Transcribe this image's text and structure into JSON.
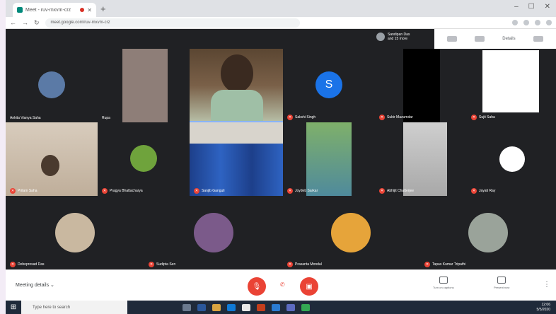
{
  "browser": {
    "tab_title": "Meet - ruv-mxvm-crz",
    "url": "meet.google.com/ruv-mxvm-crz"
  },
  "meet": {
    "presenter_label": "Sandipan Das",
    "presenter_sub": "and 15 more",
    "top_right": [
      "Share",
      "Chat",
      "Details"
    ],
    "meeting_details_label": "Meeting details",
    "present_now_label": "Turn on captions",
    "present_label": "Present now",
    "end_call_symbol": "✆"
  },
  "participants": [
    {
      "name": "Ankita Vianya Saha",
      "muted": false
    },
    {
      "name": "Rupa",
      "muted": false
    },
    {
      "name": "Sandipan Das",
      "muted": false
    },
    {
      "name": "Sakshi Singh",
      "muted": true
    },
    {
      "name": "Subir Mazumdar",
      "muted": true
    },
    {
      "name": "Sujit Saha",
      "muted": true
    },
    {
      "name": "Pritam Saha",
      "muted": true
    },
    {
      "name": "Pragya Bhattacharya",
      "muted": true
    },
    {
      "name": "Sanjib Ganguli",
      "muted": true
    },
    {
      "name": "Joydeb Sarkar",
      "muted": true
    },
    {
      "name": "Abhijit Chatterjee",
      "muted": true
    },
    {
      "name": "Jayati Ray",
      "muted": true
    },
    {
      "name": "Deboprosad Das",
      "muted": true
    },
    {
      "name": "Sudipta Sen",
      "muted": true
    },
    {
      "name": "Prasanta Mondal",
      "muted": true
    },
    {
      "name": "Tapas Kumar Tripathi",
      "muted": true
    }
  ],
  "taskbar": {
    "search_placeholder": "Type here to search",
    "time": "12:06",
    "date": "5/5/2020"
  },
  "colors": {
    "meet_dark": "#202124",
    "tile": "#3c4043",
    "red": "#ea4335",
    "avatar_blue": "#1a73e8"
  }
}
